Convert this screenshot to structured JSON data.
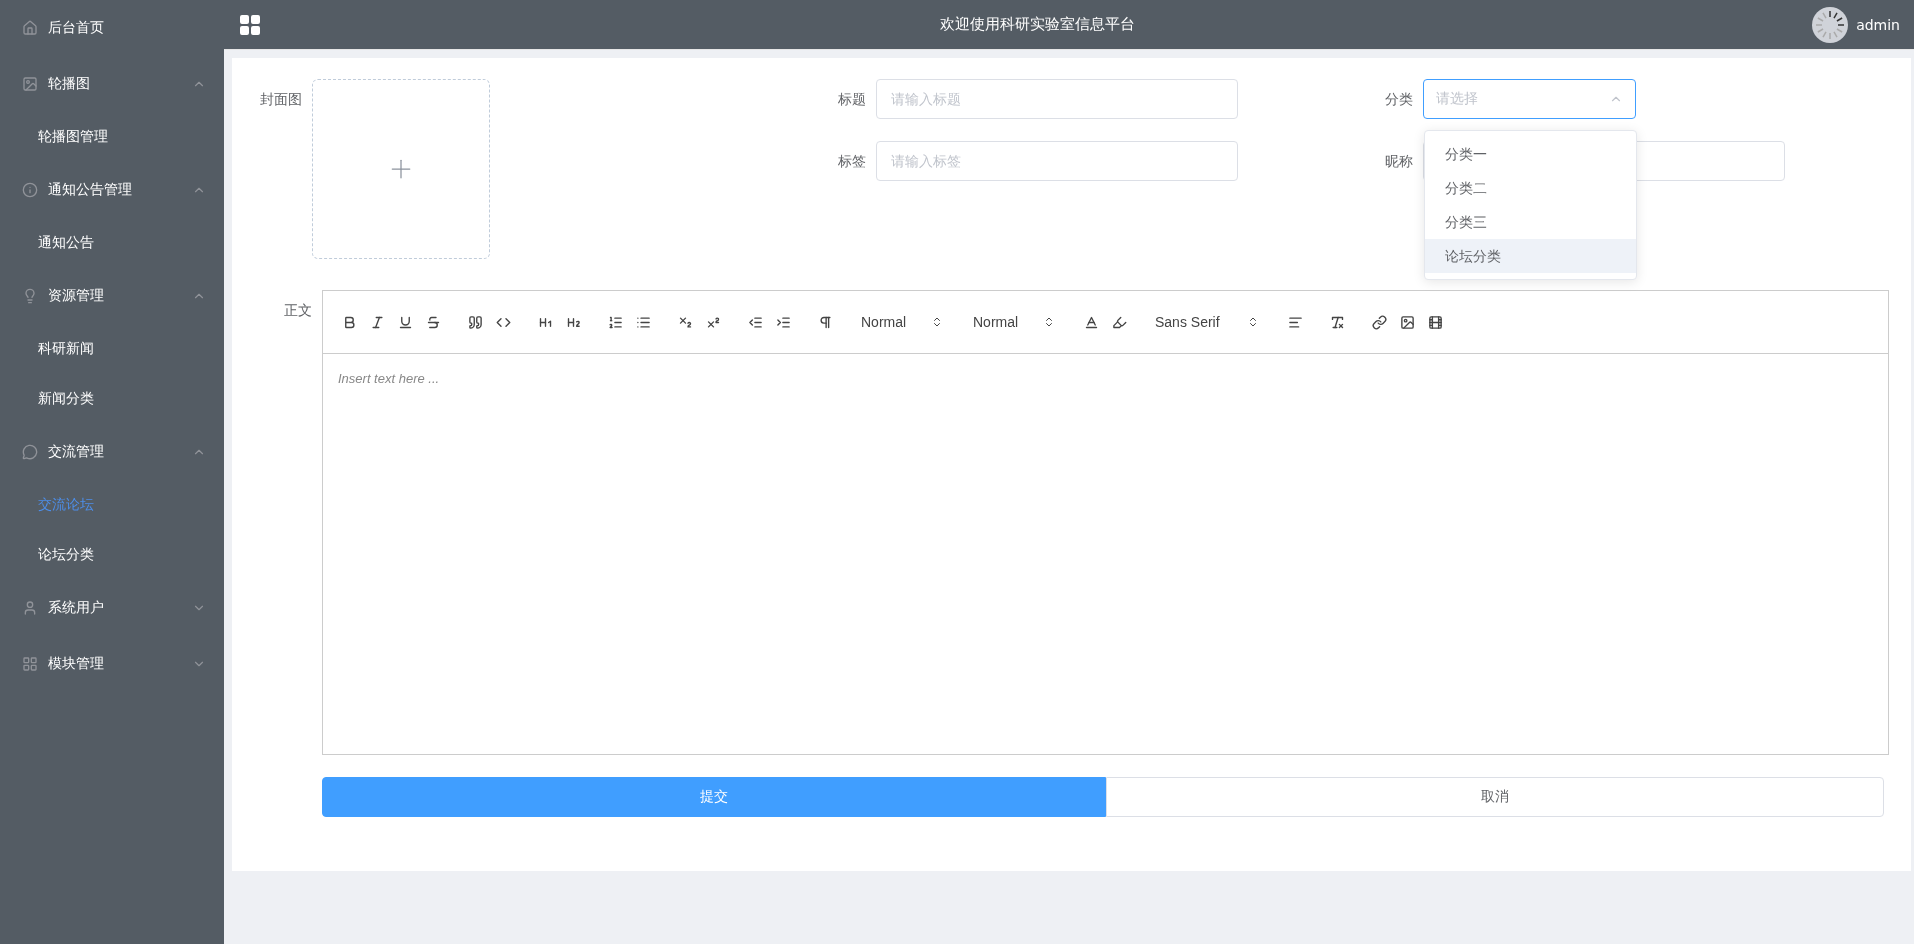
{
  "sidebar": {
    "items": [
      {
        "kind": "link",
        "label": "后台首页",
        "selected": false
      },
      {
        "kind": "group",
        "label": "轮播图",
        "expanded": true,
        "children": [
          {
            "label": "轮播图管理",
            "selected": false
          }
        ]
      },
      {
        "kind": "group",
        "label": "通知公告管理",
        "expanded": true,
        "children": [
          {
            "label": "通知公告",
            "selected": false
          }
        ]
      },
      {
        "kind": "group",
        "label": "资源管理",
        "expanded": true,
        "children": [
          {
            "label": "科研新闻",
            "selected": false
          },
          {
            "label": "新闻分类",
            "selected": false
          }
        ]
      },
      {
        "kind": "group",
        "label": "交流管理",
        "expanded": true,
        "children": [
          {
            "label": "交流论坛",
            "selected": true
          },
          {
            "label": "论坛分类",
            "selected": false
          }
        ]
      },
      {
        "kind": "group",
        "label": "系统用户",
        "expanded": false
      },
      {
        "kind": "group",
        "label": "模块管理",
        "expanded": false
      }
    ]
  },
  "header": {
    "title": "欢迎使用科研实验室信息平台",
    "user": "admin"
  },
  "form": {
    "cover_label": "封面图",
    "title": {
      "label": "标题",
      "placeholder": "请输入标题"
    },
    "tag": {
      "label": "标签",
      "placeholder": "请输入标签"
    },
    "category": {
      "label": "分类",
      "placeholder": "请选择",
      "open": true,
      "options": [
        {
          "label": "分类一",
          "highlighted": false
        },
        {
          "label": "分类二",
          "highlighted": false
        },
        {
          "label": "分类三",
          "highlighted": false
        },
        {
          "label": "论坛分类",
          "highlighted": true
        }
      ]
    },
    "nickname": {
      "label": "昵称"
    },
    "body_label": "正文",
    "editor": {
      "pickers": [
        "Normal",
        "Normal",
        "Sans Serif"
      ],
      "placeholder": "Insert text here ..."
    },
    "buttons": [
      {
        "kind": "primary",
        "label": "提交"
      },
      {
        "kind": "plain",
        "label": "取消"
      }
    ]
  }
}
